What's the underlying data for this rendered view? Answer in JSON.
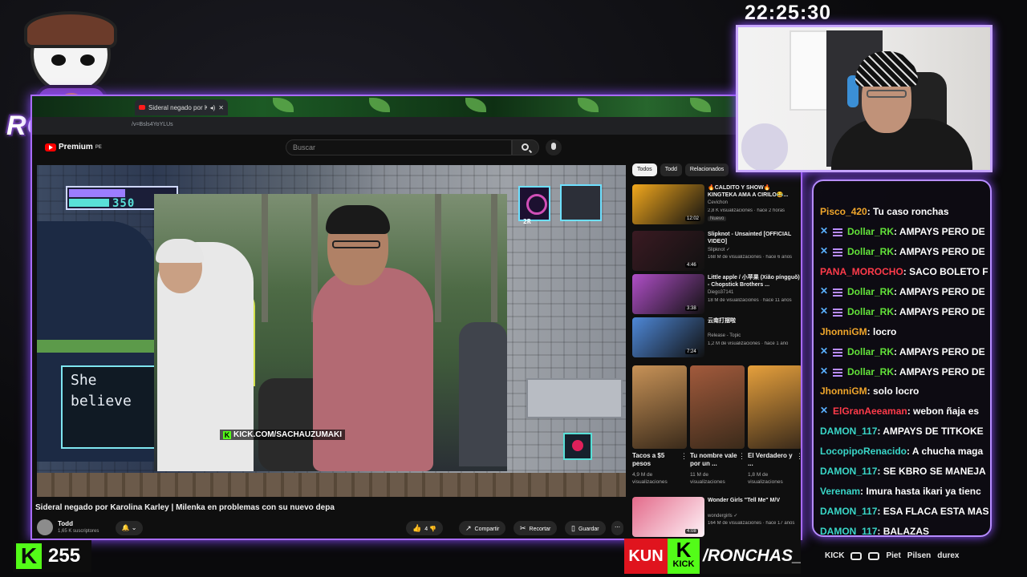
{
  "overlay": {
    "clock": "22:25:30",
    "streamer_logo_text": "RONCHAS",
    "viewer_count": "255",
    "banner": {
      "red_text": "KUN",
      "green_text": "KICK",
      "green_letter": "K",
      "handle": "/RONCHAS_"
    },
    "sponsors": [
      "KICK",
      "Piet",
      "Pilsen",
      "durex"
    ]
  },
  "browser": {
    "tab_title": "Sideral negado por Karolina",
    "address": "/v=Bsls4YoYLUs"
  },
  "youtube": {
    "logo": "Premium",
    "logo_region": "PE",
    "search_placeholder": "Buscar",
    "video": {
      "title": "Sideral negado por Karolina Karley | Milenka en problemas con su nuevo depa",
      "channel": "Todd",
      "subscribers": "1,65 K suscriptores",
      "likes": "4",
      "share": "Compartir",
      "clip": "Recortar",
      "save": "Guardar",
      "more": "⋯",
      "bell": "🔔 ⌄"
    },
    "game_hud": {
      "score": "350",
      "slot_label": "2R",
      "dialog": "She believе our"
    },
    "clip_watermark": "KICK.COM/SACHAUZUMAKI",
    "chips": [
      "Todos",
      "Todd",
      "Relacionados"
    ],
    "recommendations": [
      {
        "title": "🔥CALDITO Y SHOW🔥 KINGTEKA AMA A CIRILO😂...",
        "channel": "Cevichon",
        "meta": "2,8 K visualizaciones · hace 2 horas",
        "badge": "Nuevo",
        "duration": "12:02",
        "color": "#f2a81d"
      },
      {
        "title": "Slipknot - Unsainted [OFFICIAL VIDEO]",
        "channel": "Slipknot ✓",
        "meta": "168 M de visualizaciones · hace 6 años",
        "badge": "",
        "duration": "4:46",
        "color": "#3a1a22"
      },
      {
        "title": "Little apple / 小苹果 (Xiǎo píngguǒ) - Chopstick Brothers ...",
        "channel": "Diego37141",
        "meta": "18 M de visualizaciones · hace 11 años",
        "badge": "",
        "duration": "3:38",
        "color": "#b04fc8"
      },
      {
        "title": "云南打摆啦",
        "channel": "Release - Topic",
        "meta": "1,2 M de visualizaciones · hace 1 año",
        "badge": "",
        "duration": "7:24",
        "color": "#4e88d8"
      }
    ],
    "shorts": [
      {
        "title": "Tacos a $5 pesos",
        "views": "4,9 M de visualizaciones",
        "color": "#c79257"
      },
      {
        "title": "Tu nombre vale por un ...",
        "views": "11 M de visualizaciones",
        "color": "#a25a3c"
      },
      {
        "title": "El Verdadero y ...",
        "views": "1,8 M de visualizaciones",
        "color": "#e6a03c"
      }
    ],
    "end_card": {
      "title": "Wonder Girls \"Tell Me\" M/V",
      "channel": "wondergirls ✓",
      "meta": "164 M de visualizaciones · hace 17 años",
      "duration": "4:08",
      "color": "#e36a8a"
    }
  },
  "chat": {
    "messages": [
      {
        "user": "Pisco_420",
        "text": ": Tu caso ronchas",
        "color": "#f0a62b",
        "badges": false
      },
      {
        "user": "Dollar_RK",
        "text": ": AMPAYS PERO DE",
        "color": "#63e23a",
        "badges": true
      },
      {
        "user": "Dollar_RK",
        "text": ": AMPAYS PERO DE",
        "color": "#63e23a",
        "badges": true
      },
      {
        "user": "PANA_MOROCHO",
        "text": ": SACO BOLETO F",
        "color": "#ff3b4a",
        "badges": false
      },
      {
        "user": "Dollar_RK",
        "text": ": AMPAYS PERO DE",
        "color": "#63e23a",
        "badges": true
      },
      {
        "user": "Dollar_RK",
        "text": ": AMPAYS PERO DE",
        "color": "#63e23a",
        "badges": true
      },
      {
        "user": "JhonniGM",
        "text": ": locro",
        "color": "#f0a62b",
        "badges": false
      },
      {
        "user": "Dollar_RK",
        "text": ": AMPAYS PERO DE",
        "color": "#63e23a",
        "badges": true
      },
      {
        "user": "Dollar_RK",
        "text": ": AMPAYS PERO DE",
        "color": "#63e23a",
        "badges": true
      },
      {
        "user": "JhonniGM",
        "text": ": solo locro",
        "color": "#f0a62b",
        "badges": false
      },
      {
        "user": "ElGranAeeaman",
        "text": ": webon ñaja es",
        "color": "#ff3b4a",
        "badges": false,
        "one_badge": true
      },
      {
        "user": "DAMON_117",
        "text": ": AMPAYS DE TITKOKE",
        "color": "#39d6c8",
        "badges": false
      },
      {
        "user": "LocopipoRenacido",
        "text": ": A chucha maga",
        "color": "#39d6c8",
        "badges": false
      },
      {
        "user": "DAMON_117",
        "text": ": SE KBRO SE MANEJA",
        "color": "#39d6c8",
        "badges": false
      },
      {
        "user": "Verenam",
        "text": ": Imura hasta ikari ya tienc",
        "color": "#39d6c8",
        "badges": false
      },
      {
        "user": "DAMON_117",
        "text": ": ESA FLACA ESTA MAS",
        "color": "#39d6c8",
        "badges": false
      },
      {
        "user": "DAMON_117",
        "text": ": BALAZAS",
        "color": "#39d6c8",
        "badges": false
      }
    ]
  }
}
